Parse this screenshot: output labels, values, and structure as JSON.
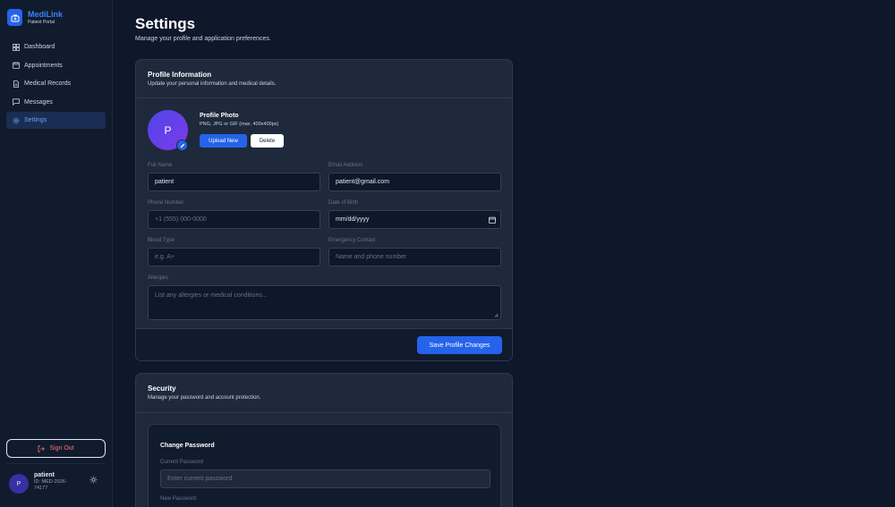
{
  "app": {
    "name": "MediLink",
    "subtitle": "Patient Portal"
  },
  "sidebar": {
    "items": [
      {
        "label": "Dashboard",
        "icon": "grid-icon",
        "active": false
      },
      {
        "label": "Appointments",
        "icon": "calendar-icon",
        "active": false
      },
      {
        "label": "Medical Records",
        "icon": "file-icon",
        "active": false
      },
      {
        "label": "Messages",
        "icon": "message-icon",
        "active": false
      },
      {
        "label": "Settings",
        "icon": "gear-icon",
        "active": true
      }
    ],
    "sign_out_label": "Sign Out",
    "user": {
      "initial": "P",
      "name": "patient",
      "id": "ID: MED-2026-74177"
    }
  },
  "page": {
    "title": "Settings",
    "subtitle": "Manage your profile and application preferences."
  },
  "profile": {
    "title": "Profile Information",
    "subtitle": "Update your personal information and medical details.",
    "avatar_initial": "P",
    "photo_title": "Profile Photo",
    "photo_hint": "PNG, JPG or GIF (max. 400x400px)",
    "upload_label": "Upload New",
    "delete_label": "Delete",
    "fields": {
      "full_name": {
        "label": "Full Name",
        "value": "patient"
      },
      "email": {
        "label": "Email Address",
        "value": "patient@gmail.com"
      },
      "phone": {
        "label": "Phone Number",
        "placeholder": "+1 (555) 000-0000"
      },
      "dob": {
        "label": "Date of Birth",
        "value": "mm/dd/yyyy"
      },
      "blood": {
        "label": "Blood Type",
        "placeholder": "e.g. A+"
      },
      "emergency": {
        "label": "Emergency Contact",
        "placeholder": "Name and phone number"
      },
      "allergies": {
        "label": "Allergies",
        "placeholder": "List any allergies or medical conditions..."
      }
    },
    "save_label": "Save Profile Changes"
  },
  "security": {
    "title": "Security",
    "subtitle": "Manage your password and account protection.",
    "change_password_title": "Change Password",
    "current_label": "Current Password",
    "current_placeholder": "Enter current password",
    "new_label": "New Password"
  },
  "colors": {
    "accent": "#2563eb",
    "bg": "#0f172a",
    "card": "#1e293b",
    "danger": "#f87171"
  }
}
